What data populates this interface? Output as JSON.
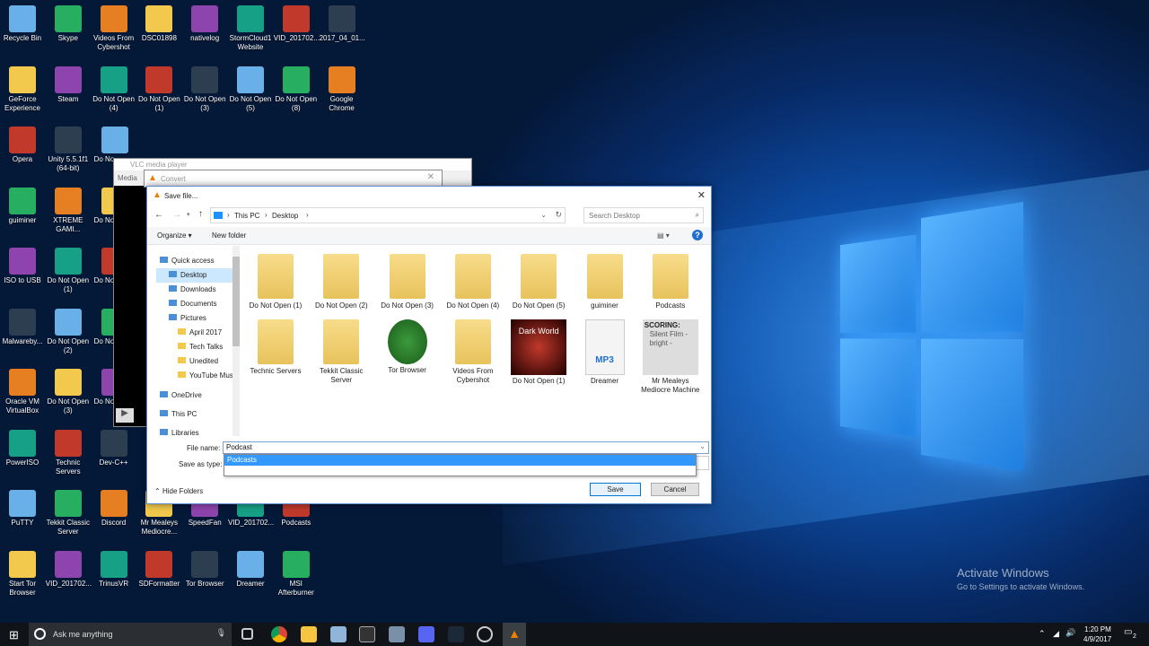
{
  "desktop": {
    "icons": [
      [
        "Recycle Bin",
        "GeForce Experience",
        "Opera",
        "guiminer",
        "ISO to USB",
        "Malwareby...",
        "Oracle VM VirtualBox",
        "PowerISO",
        "PuTTY",
        "Start Tor Browser"
      ],
      [
        "Skype",
        "Steam",
        "Unity 5.5.1f1 (64-bit)",
        "XTREME GAMI...",
        "Do Not Open (1)",
        "Do Not Open (2)",
        "Do Not Open (3)",
        "Technic Servers",
        "Tekkit Classic Server",
        "VID_201702..."
      ],
      [
        "Videos From Cybershot",
        "Do Not Open (4)",
        "Do No...",
        "Do No...",
        "Do No...",
        "Do No...",
        "Do No...",
        "Dev-C++",
        "Discord",
        "TrinusVR"
      ],
      [
        "DSC01898",
        "Do Not Open (1)",
        "",
        "",
        "",
        "",
        "",
        "",
        "Mr Mealeys Mediocre...",
        "SDFormatter"
      ],
      [
        "nativelog",
        "Do Not Open (3)",
        "",
        "",
        "",
        "",
        "",
        "",
        "SpeedFan",
        "Tor Browser"
      ],
      [
        "StormCloud1 Website",
        "Do Not Open (5)",
        "",
        "",
        "",
        "",
        "",
        "",
        "VID_201702...",
        "Dreamer"
      ],
      [
        "VID_201702...",
        "Do Not Open (8)",
        "",
        "",
        "",
        "",
        "",
        "",
        "Podcasts",
        "MSI Afterburner"
      ],
      [
        "2017_04_01...",
        "Google Chrome",
        "",
        "",
        "",
        "",
        "",
        "",
        "",
        ""
      ]
    ]
  },
  "bg_windows": {
    "vlc_title": "VLC media player",
    "vlc_menu": "Media",
    "convert_title": "Convert"
  },
  "dialog": {
    "title": "Save file...",
    "breadcrumb": [
      "This PC",
      "Desktop"
    ],
    "search_placeholder": "Search Desktop",
    "organize": "Organize ▾",
    "new_folder": "New folder",
    "nav": [
      "Quick access",
      "Desktop",
      "Downloads",
      "Documents",
      "Pictures",
      "April 2017",
      "Tech Talks",
      "Unedited",
      "YouTube Music",
      "OneDrive",
      "This PC",
      "Libraries"
    ],
    "files": [
      "Do Not Open (1)",
      "Do Not Open (2)",
      "Do Not Open (3)",
      "Do Not Open (4)",
      "Do Not Open (5)",
      "guiminer",
      "Podcasts",
      "Technic Servers",
      "Tekkit Classic Server",
      "Tor Browser",
      "Videos From Cybershot",
      "Do Not Open (1)",
      "Dreamer",
      "Mr Mealeys Mediocre Machine"
    ],
    "file_name_label": "File name:",
    "file_name_value": "Podcast",
    "save_as_type_label": "Save as type:",
    "autocomplete": [
      "Podcasts"
    ],
    "hide_folders": "Hide Folders",
    "save": "Save",
    "cancel": "Cancel",
    "thumb_text": {
      "dark_world": "Dark World",
      "mp3": "MP3",
      "scoring": "SCORING:",
      "silent": "Silent Film - bright -"
    }
  },
  "watermark": {
    "title": "Activate Windows",
    "subtitle": "Go to Settings to activate Windows."
  },
  "taskbar": {
    "search_placeholder": "Ask me anything",
    "time": "1:20 PM",
    "date": "4/9/2017",
    "notifications": "2"
  },
  "colors": {
    "accent": "#0078d7",
    "selection": "#3399ff",
    "taskbar": "#101418"
  }
}
